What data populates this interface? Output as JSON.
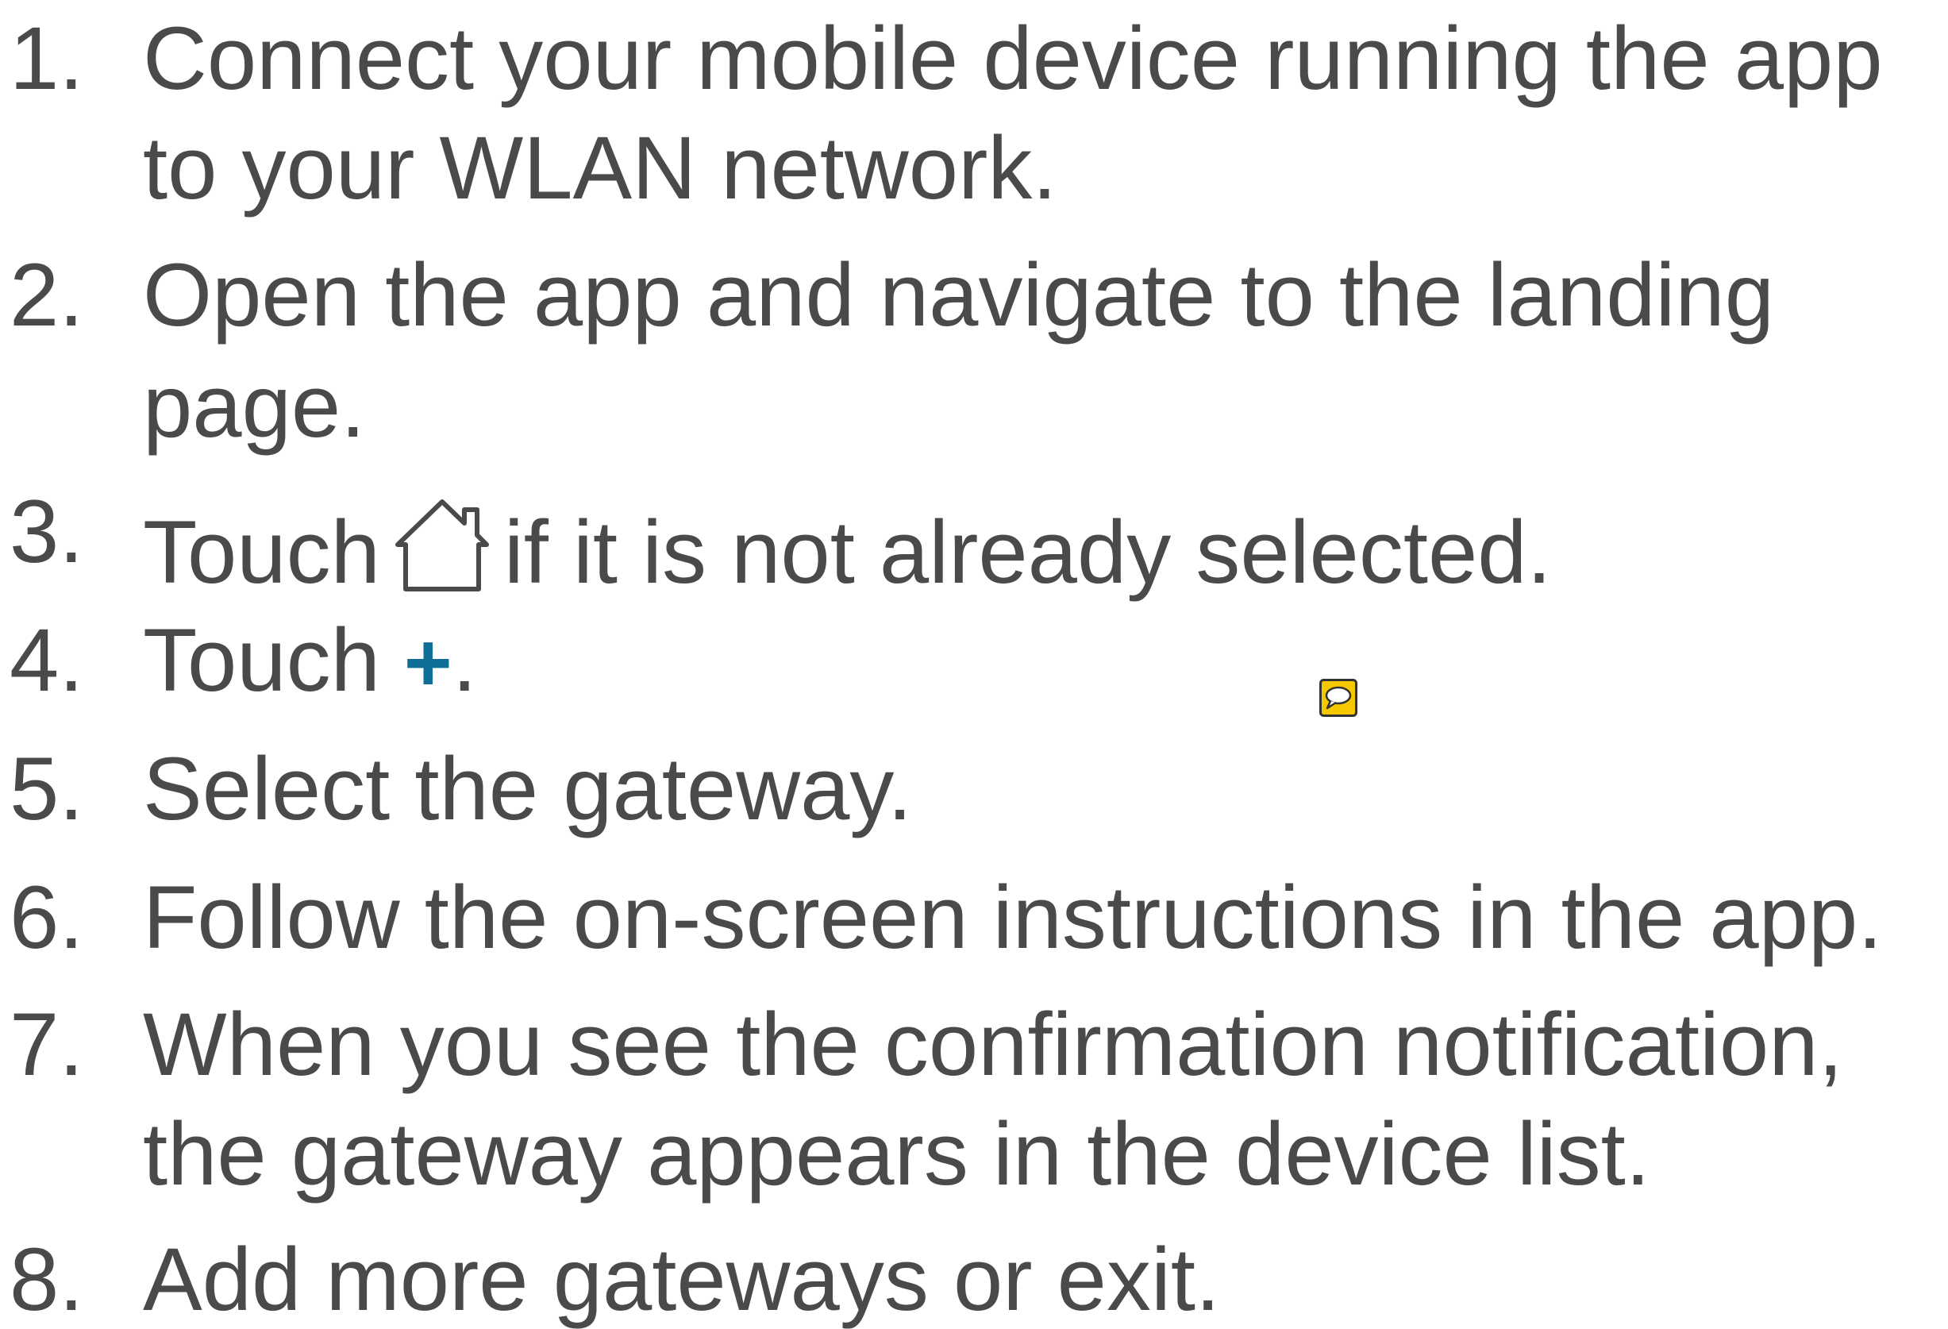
{
  "steps": [
    {
      "number": "1.",
      "lines": [
        "Connect your mobile device running the app",
        "to your WLAN network."
      ]
    },
    {
      "number": "2.",
      "lines": [
        "Open the app and navigate to the landing",
        "page."
      ]
    },
    {
      "number": "3.",
      "before": "Touch",
      "icon": "home-icon",
      "after": "if it is not already selected."
    },
    {
      "number": "4.",
      "before": "Touch",
      "icon": "plus-icon",
      "icon_glyph": "+",
      "after": "."
    },
    {
      "number": "5.",
      "lines": [
        "Select the gateway."
      ]
    },
    {
      "number": "6.",
      "lines": [
        "Follow the on-screen instructions in the app."
      ]
    },
    {
      "number": "7.",
      "lines": [
        "When you see the confirmation notification,",
        "the gateway appears in the device list."
      ]
    },
    {
      "number": "8.",
      "lines": [
        "Add more gateways or exit."
      ]
    }
  ],
  "colors": {
    "text": "#4a4a4a",
    "plus_accent": "#0e6e96",
    "comment_fill": "#f5c800",
    "comment_border": "#333333"
  },
  "annotation": {
    "icon": "comment-icon"
  }
}
